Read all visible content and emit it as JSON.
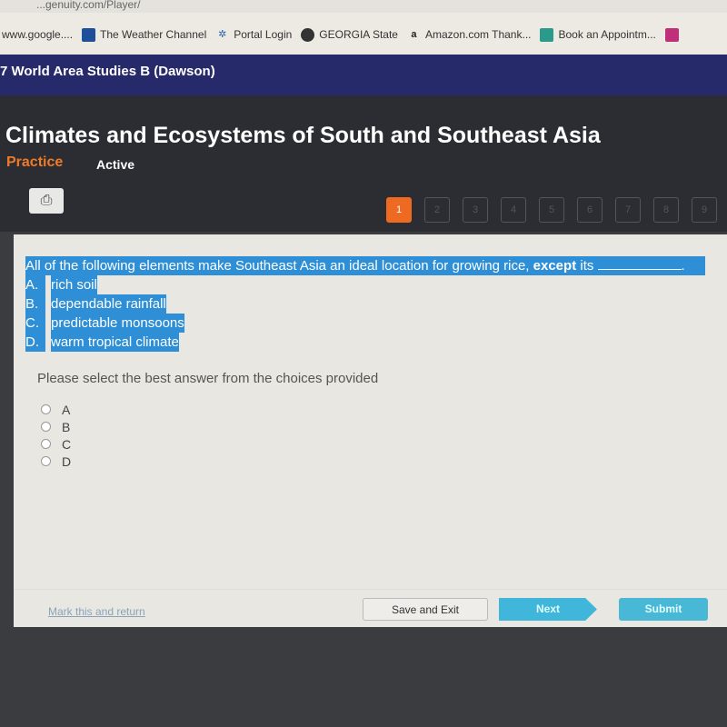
{
  "browser": {
    "url": "...genuity.com/Player/",
    "bookmarks": [
      {
        "label": "www.google....",
        "icon": ""
      },
      {
        "label": "The Weather Channel",
        "icon": "weather-channel-icon"
      },
      {
        "label": "Portal Login",
        "icon": "portal-icon"
      },
      {
        "label": "GEORGIA State",
        "icon": "globe-icon"
      },
      {
        "label": "Amazon.com Thank...",
        "icon": "amazon-icon"
      },
      {
        "label": "Book an Appointm...",
        "icon": "grid-icon"
      }
    ]
  },
  "course": "7 World Area Studies B (Dawson)",
  "header": {
    "title": "Climates and Ecosystems of South and Southeast Asia",
    "mode": "Practice",
    "status": "Active"
  },
  "questions": [
    "1",
    "2",
    "3",
    "4",
    "5",
    "6",
    "7",
    "8",
    "9"
  ],
  "current_question": 1,
  "question": {
    "text": "All of the following elements make Southeast Asia an ideal location for growing rice,",
    "emphasis": "except",
    "after": "its",
    "options": [
      {
        "letter": "A.",
        "text": "rich soil"
      },
      {
        "letter": "B.",
        "text": "dependable rainfall"
      },
      {
        "letter": "C.",
        "text": "predictable monsoons"
      },
      {
        "letter": "D.",
        "text": "warm tropical climate"
      }
    ]
  },
  "prompt": "Please select the best answer from the choices provided",
  "choices": [
    "A",
    "B",
    "C",
    "D"
  ],
  "footer": {
    "mark": "Mark this and return",
    "save": "Save and Exit",
    "next": "Next",
    "submit": "Submit"
  },
  "colors": {
    "accent": "#ee6a22",
    "nav": "#26296a",
    "button": "#3fb6da",
    "highlight": "#2f8fd6"
  }
}
